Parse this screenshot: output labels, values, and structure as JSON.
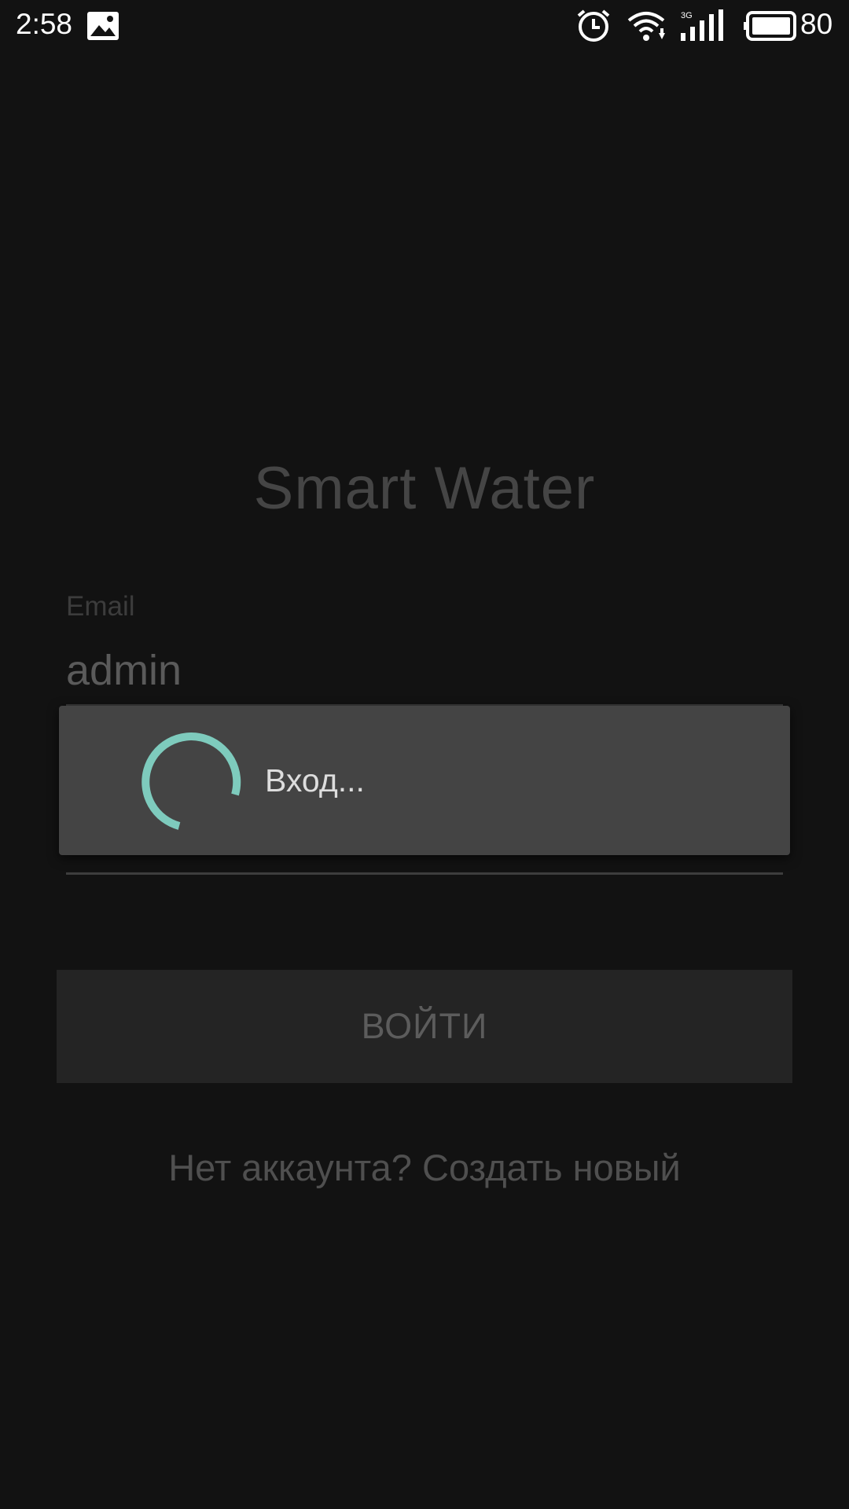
{
  "status_bar": {
    "time": "2:58",
    "battery_percent": "80",
    "network_type": "3G",
    "icons": [
      "gallery-icon",
      "alarm-icon",
      "wifi-icon",
      "signal-icon",
      "battery-icon"
    ]
  },
  "login_form": {
    "app_title": "Smart Water",
    "email": {
      "label": "Email",
      "value": "admin"
    },
    "login_button_label": "ВОЙТИ",
    "signup_link": "Нет аккаунта? Создать новый"
  },
  "progress_dialog": {
    "message": "Вход...",
    "spinner_color": "#7ecbbd"
  },
  "colors": {
    "background": "#121212",
    "dialog_background": "#444444",
    "accent": "#7ecbbd"
  }
}
